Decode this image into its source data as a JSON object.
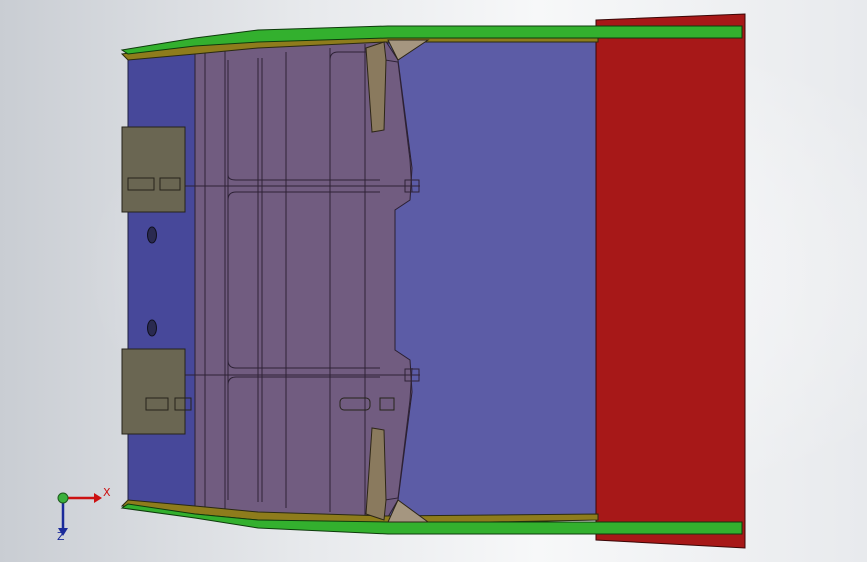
{
  "viewport": {
    "colors": {
      "background": "#e9ebee",
      "blue_plate": "#5a5aa6",
      "purple_frame": "#6f5b7e",
      "red_end": "#a81818",
      "green_rail": "#2fb02a",
      "olive_rail": "#8c7a1a",
      "grey_block": "#6a6652"
    }
  },
  "triad": {
    "x_label": "X",
    "z_label": "Z",
    "icons": [
      "origin-sphere-icon",
      "x-axis-arrow-icon",
      "z-axis-arrow-icon"
    ]
  }
}
